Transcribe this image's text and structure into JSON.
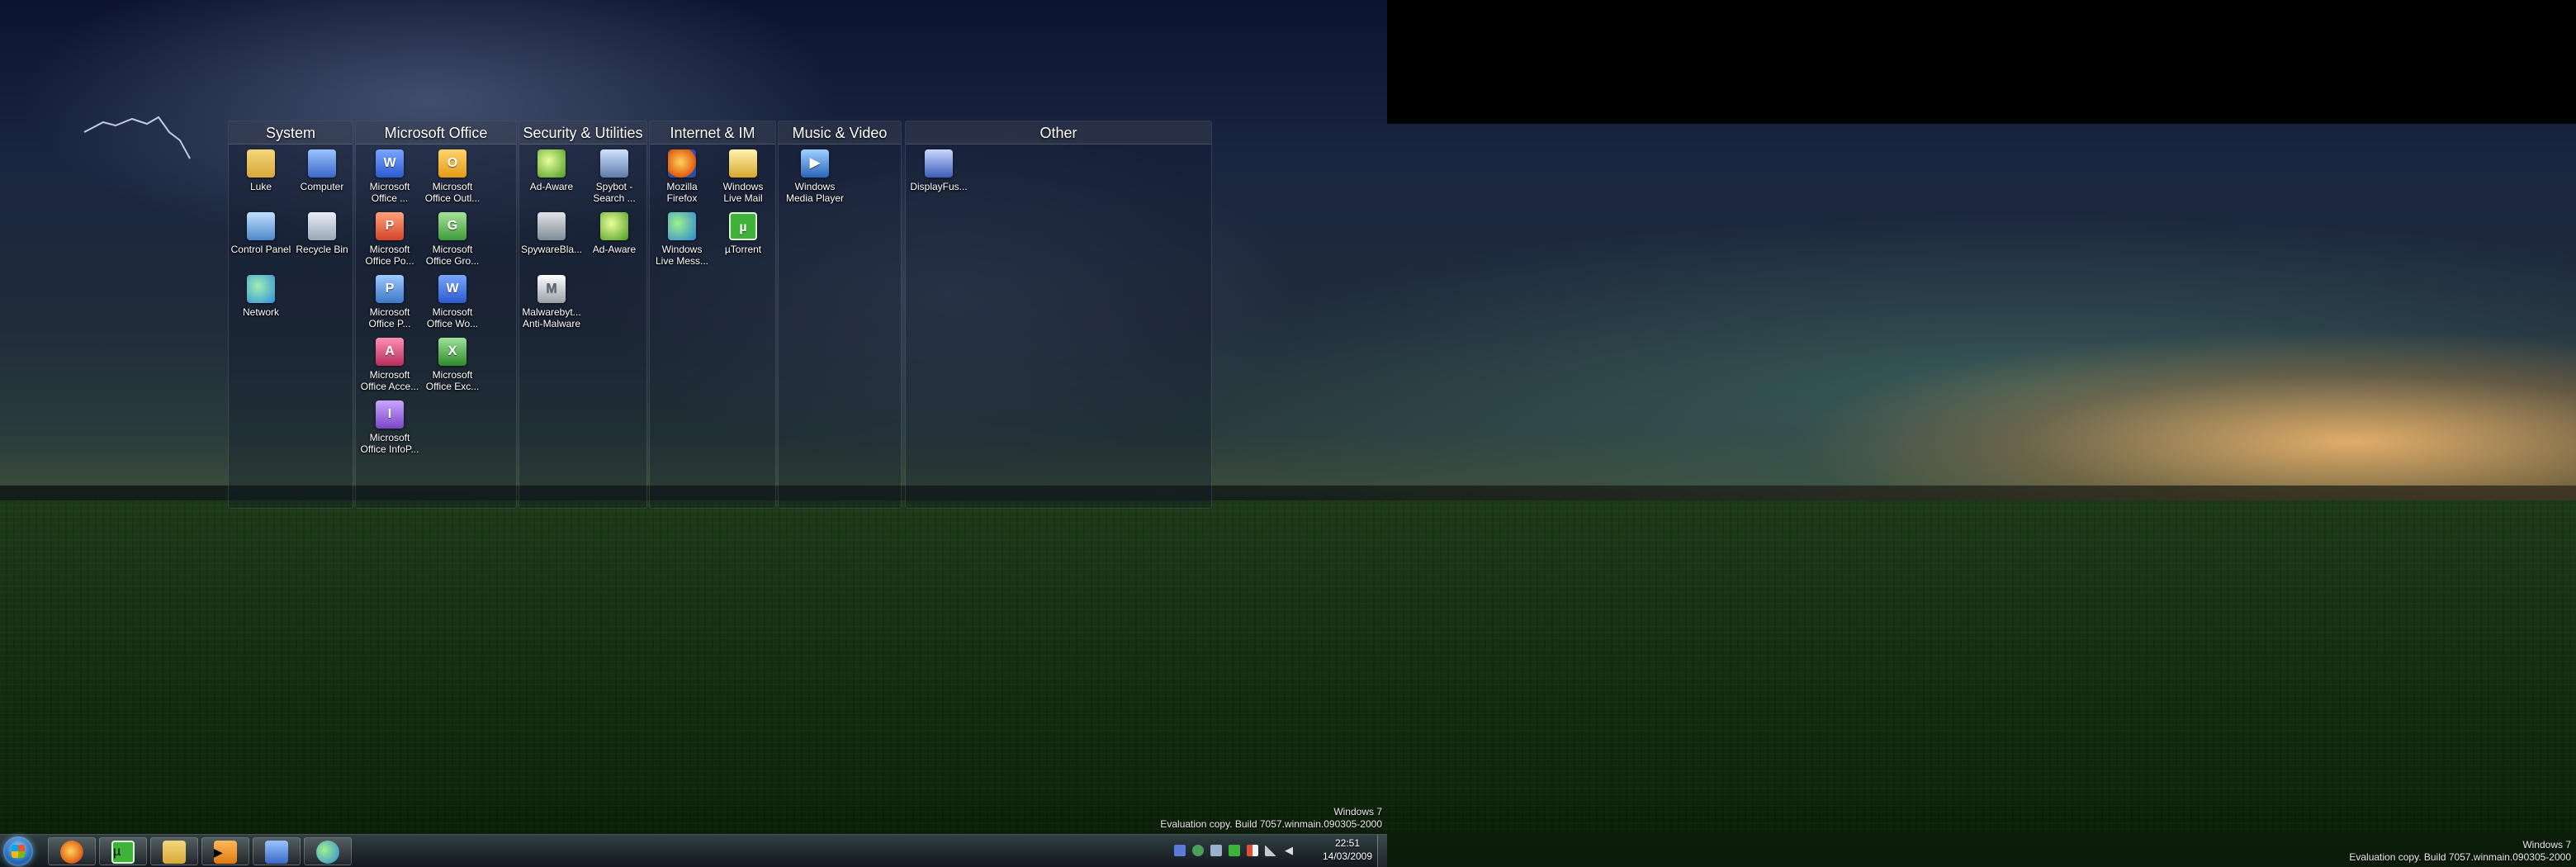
{
  "fences": [
    {
      "title": "System",
      "icons": [
        {
          "label": "Luke",
          "icon": "user-folder-icon"
        },
        {
          "label": "Computer",
          "icon": "computer-icon"
        },
        {
          "label": "Control Panel",
          "icon": "control-panel-icon"
        },
        {
          "label": "Recycle Bin",
          "icon": "recycle-bin-icon"
        },
        {
          "label": "Network",
          "icon": "network-icon"
        }
      ]
    },
    {
      "title": "Microsoft Office",
      "icons": [
        {
          "label": "Microsoft\nOffice ...",
          "icon": "word-icon"
        },
        {
          "label": "Microsoft\nOffice Outl...",
          "icon": "outlook-icon"
        },
        {
          "label": "Microsoft\nOffice Po...",
          "icon": "powerpoint-icon"
        },
        {
          "label": "Microsoft\nOffice Gro...",
          "icon": "groove-icon"
        },
        {
          "label": "Microsoft\nOffice P...",
          "icon": "project-icon"
        },
        {
          "label": "Microsoft\nOffice Wo...",
          "icon": "word-icon"
        },
        {
          "label": "Microsoft\nOffice Acce...",
          "icon": "access-icon"
        },
        {
          "label": "Microsoft\nOffice Exc...",
          "icon": "excel-icon"
        },
        {
          "label": "Microsoft\nOffice InfoP...",
          "icon": "infopath-icon"
        }
      ]
    },
    {
      "title": "Security & Utilities",
      "icons": [
        {
          "label": "Ad-Aware",
          "icon": "adaware-icon"
        },
        {
          "label": "Spybot -\nSearch ...",
          "icon": "spybot-icon"
        },
        {
          "label": "SpywareBla...",
          "icon": "spywareblaster-icon"
        },
        {
          "label": "Ad-Aware",
          "icon": "adaware-icon"
        },
        {
          "label": "Malwarebyt...\nAnti-Malware",
          "icon": "malwarebytes-icon"
        }
      ]
    },
    {
      "title": "Internet & IM",
      "icons": [
        {
          "label": "Mozilla\nFirefox",
          "icon": "firefox-icon"
        },
        {
          "label": "Windows\nLive Mail",
          "icon": "live-mail-icon"
        },
        {
          "label": "Windows\nLive Mess...",
          "icon": "messenger-icon"
        },
        {
          "label": "µTorrent",
          "icon": "utorrent-icon"
        }
      ]
    },
    {
      "title": "Music & Video",
      "icons": [
        {
          "label": "Windows\nMedia Player",
          "icon": "media-player-icon"
        }
      ]
    },
    {
      "title": "Other",
      "icons": [
        {
          "label": "DisplayFus...",
          "icon": "displayfusion-icon"
        }
      ]
    }
  ],
  "watermark_primary": {
    "line1": "Windows 7",
    "line2": "Evaluation copy. Build 7057.winmain.090305-2000"
  },
  "watermark_secondary": {
    "line1": "Windows 7",
    "line2": "Evaluation copy. Build 7057.winmain.090305-2000"
  },
  "taskbar": {
    "pinned": [
      {
        "name": "firefox",
        "icon": "firefox-icon"
      },
      {
        "name": "utorrent",
        "icon": "utorrent-icon"
      },
      {
        "name": "explorer",
        "icon": "folder-icon"
      },
      {
        "name": "media-player",
        "icon": "media-player-icon"
      },
      {
        "name": "remote-desktop",
        "icon": "monitor-icon"
      },
      {
        "name": "messenger",
        "icon": "messenger-icon"
      }
    ],
    "tray_icons": [
      "displayfusion-icon",
      "security-icon",
      "network-icon",
      "utorrent-icon",
      "flag-icon",
      "signal-icon",
      "volume-icon"
    ],
    "clock": {
      "time": "22:51",
      "date": "14/03/2009"
    }
  }
}
